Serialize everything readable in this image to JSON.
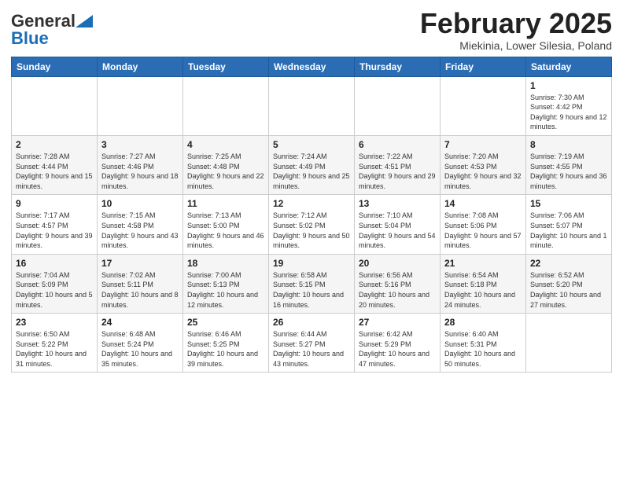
{
  "header": {
    "logo_general": "General",
    "logo_blue": "Blue",
    "month": "February 2025",
    "location": "Miekinia, Lower Silesia, Poland"
  },
  "weekdays": [
    "Sunday",
    "Monday",
    "Tuesday",
    "Wednesday",
    "Thursday",
    "Friday",
    "Saturday"
  ],
  "weeks": [
    [
      {
        "day": "",
        "detail": ""
      },
      {
        "day": "",
        "detail": ""
      },
      {
        "day": "",
        "detail": ""
      },
      {
        "day": "",
        "detail": ""
      },
      {
        "day": "",
        "detail": ""
      },
      {
        "day": "",
        "detail": ""
      },
      {
        "day": "1",
        "detail": "Sunrise: 7:30 AM\nSunset: 4:42 PM\nDaylight: 9 hours and 12 minutes."
      }
    ],
    [
      {
        "day": "2",
        "detail": "Sunrise: 7:28 AM\nSunset: 4:44 PM\nDaylight: 9 hours and 15 minutes."
      },
      {
        "day": "3",
        "detail": "Sunrise: 7:27 AM\nSunset: 4:46 PM\nDaylight: 9 hours and 18 minutes."
      },
      {
        "day": "4",
        "detail": "Sunrise: 7:25 AM\nSunset: 4:48 PM\nDaylight: 9 hours and 22 minutes."
      },
      {
        "day": "5",
        "detail": "Sunrise: 7:24 AM\nSunset: 4:49 PM\nDaylight: 9 hours and 25 minutes."
      },
      {
        "day": "6",
        "detail": "Sunrise: 7:22 AM\nSunset: 4:51 PM\nDaylight: 9 hours and 29 minutes."
      },
      {
        "day": "7",
        "detail": "Sunrise: 7:20 AM\nSunset: 4:53 PM\nDaylight: 9 hours and 32 minutes."
      },
      {
        "day": "8",
        "detail": "Sunrise: 7:19 AM\nSunset: 4:55 PM\nDaylight: 9 hours and 36 minutes."
      }
    ],
    [
      {
        "day": "9",
        "detail": "Sunrise: 7:17 AM\nSunset: 4:57 PM\nDaylight: 9 hours and 39 minutes."
      },
      {
        "day": "10",
        "detail": "Sunrise: 7:15 AM\nSunset: 4:58 PM\nDaylight: 9 hours and 43 minutes."
      },
      {
        "day": "11",
        "detail": "Sunrise: 7:13 AM\nSunset: 5:00 PM\nDaylight: 9 hours and 46 minutes."
      },
      {
        "day": "12",
        "detail": "Sunrise: 7:12 AM\nSunset: 5:02 PM\nDaylight: 9 hours and 50 minutes."
      },
      {
        "day": "13",
        "detail": "Sunrise: 7:10 AM\nSunset: 5:04 PM\nDaylight: 9 hours and 54 minutes."
      },
      {
        "day": "14",
        "detail": "Sunrise: 7:08 AM\nSunset: 5:06 PM\nDaylight: 9 hours and 57 minutes."
      },
      {
        "day": "15",
        "detail": "Sunrise: 7:06 AM\nSunset: 5:07 PM\nDaylight: 10 hours and 1 minute."
      }
    ],
    [
      {
        "day": "16",
        "detail": "Sunrise: 7:04 AM\nSunset: 5:09 PM\nDaylight: 10 hours and 5 minutes."
      },
      {
        "day": "17",
        "detail": "Sunrise: 7:02 AM\nSunset: 5:11 PM\nDaylight: 10 hours and 8 minutes."
      },
      {
        "day": "18",
        "detail": "Sunrise: 7:00 AM\nSunset: 5:13 PM\nDaylight: 10 hours and 12 minutes."
      },
      {
        "day": "19",
        "detail": "Sunrise: 6:58 AM\nSunset: 5:15 PM\nDaylight: 10 hours and 16 minutes."
      },
      {
        "day": "20",
        "detail": "Sunrise: 6:56 AM\nSunset: 5:16 PM\nDaylight: 10 hours and 20 minutes."
      },
      {
        "day": "21",
        "detail": "Sunrise: 6:54 AM\nSunset: 5:18 PM\nDaylight: 10 hours and 24 minutes."
      },
      {
        "day": "22",
        "detail": "Sunrise: 6:52 AM\nSunset: 5:20 PM\nDaylight: 10 hours and 27 minutes."
      }
    ],
    [
      {
        "day": "23",
        "detail": "Sunrise: 6:50 AM\nSunset: 5:22 PM\nDaylight: 10 hours and 31 minutes."
      },
      {
        "day": "24",
        "detail": "Sunrise: 6:48 AM\nSunset: 5:24 PM\nDaylight: 10 hours and 35 minutes."
      },
      {
        "day": "25",
        "detail": "Sunrise: 6:46 AM\nSunset: 5:25 PM\nDaylight: 10 hours and 39 minutes."
      },
      {
        "day": "26",
        "detail": "Sunrise: 6:44 AM\nSunset: 5:27 PM\nDaylight: 10 hours and 43 minutes."
      },
      {
        "day": "27",
        "detail": "Sunrise: 6:42 AM\nSunset: 5:29 PM\nDaylight: 10 hours and 47 minutes."
      },
      {
        "day": "28",
        "detail": "Sunrise: 6:40 AM\nSunset: 5:31 PM\nDaylight: 10 hours and 50 minutes."
      },
      {
        "day": "",
        "detail": ""
      }
    ]
  ]
}
